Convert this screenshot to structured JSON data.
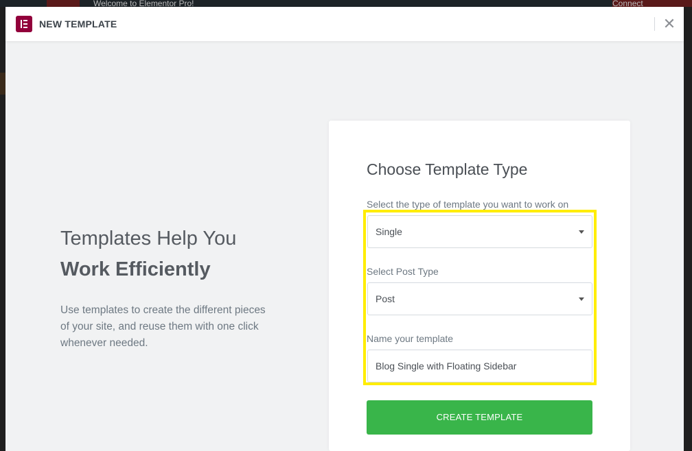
{
  "background": {
    "notice_text": "Welcome to Elementor Pro!",
    "connect_label": "Connect"
  },
  "modal": {
    "title": "NEW TEMPLATE",
    "close_icon": "close-icon",
    "logo_icon": "elementor-logo-icon",
    "accent_color": "#92003b"
  },
  "intro": {
    "heading_line1": "Templates Help You",
    "heading_line2": "Work Efficiently",
    "description": "Use templates to create the different pieces of your site, and reuse them with one click whenever needed."
  },
  "form": {
    "title": "Choose Template Type",
    "type_label": "Select the type of template you want to work on",
    "type_value": "Single",
    "post_type_label": "Select Post Type",
    "post_type_value": "Post",
    "name_label": "Name your template",
    "name_value": "Blog Single with Floating Sidebar",
    "submit_label": "CREATE TEMPLATE",
    "submit_color": "#39b54a",
    "highlight_color": "#ffed00"
  }
}
